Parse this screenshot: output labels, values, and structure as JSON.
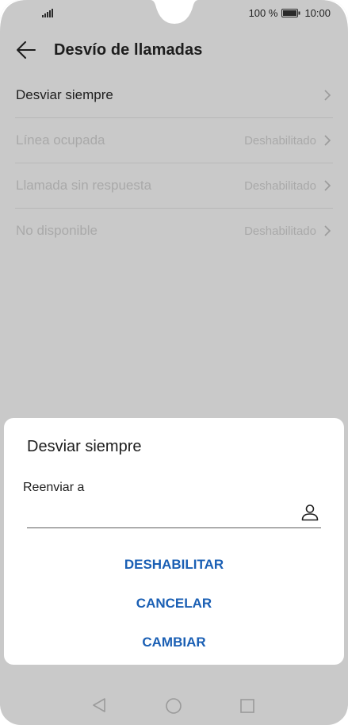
{
  "status_bar": {
    "battery_percent": "100 %",
    "time": "10:00",
    "icons": [
      "signal-icon",
      "battery-icon"
    ]
  },
  "app_bar": {
    "title": "Desvío de llamadas",
    "back_icon": "back-arrow-icon"
  },
  "settings": {
    "items": [
      {
        "label": "Desviar siempre",
        "value": "",
        "enabled": true
      },
      {
        "label": "Línea ocupada",
        "value": "Deshabilitado",
        "enabled": false
      },
      {
        "label": "Llamada sin respuesta",
        "value": "Deshabilitado",
        "enabled": false
      },
      {
        "label": "No disponible",
        "value": "Deshabilitado",
        "enabled": false
      }
    ]
  },
  "dialog": {
    "title": "Desviar siempre",
    "field_label": "Reenviar a",
    "field_value": "",
    "field_icon": "contact-icon",
    "buttons": {
      "disable": "DESHABILITAR",
      "cancel": "CANCELAR",
      "change": "CAMBIAR"
    }
  },
  "nav_bar": {
    "icons": [
      "nav-back-icon",
      "nav-home-icon",
      "nav-recent-icon"
    ]
  },
  "colors": {
    "screen_dim": "#c9c9c9",
    "accent": "#1a5fb4",
    "text_primary": "#1d1d1d",
    "text_disabled": "#a9a9a9"
  }
}
